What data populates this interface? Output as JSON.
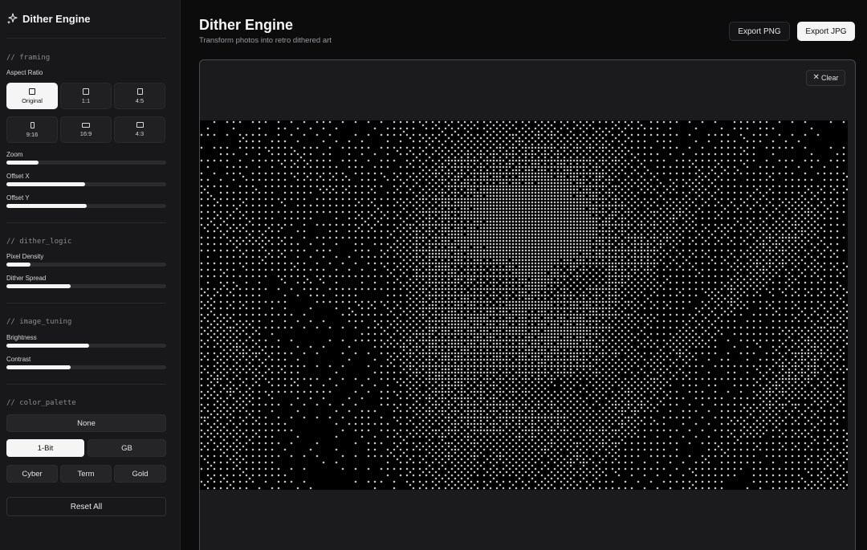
{
  "app": {
    "name": "Dither Engine"
  },
  "header": {
    "title": "Dither Engine",
    "subtitle": "Transform photos into retro dithered art",
    "export_png": "Export PNG",
    "export_jpg": "Export JPG"
  },
  "canvas": {
    "clear_label": "Clear",
    "clear_icon": "x-icon"
  },
  "framing": {
    "title": "// framing",
    "aspect_label": "Aspect Ratio",
    "ratios": [
      "Original",
      "1:1",
      "4:5",
      "9:16",
      "16:9",
      "4:3"
    ],
    "selected_ratio": "Original",
    "zoom": {
      "label": "Zoom",
      "value": 0.2
    },
    "offset_x": {
      "label": "Offset X",
      "value": 0.49
    },
    "offset_y": {
      "label": "Offset Y",
      "value": 0.5
    }
  },
  "dither_logic": {
    "title": "// dither_logic",
    "pixel_density": {
      "label": "Pixel Density",
      "value": 0.15
    },
    "dither_spread": {
      "label": "Dither Spread",
      "value": 0.4
    }
  },
  "image_tuning": {
    "title": "// image_tuning",
    "brightness": {
      "label": "Brightness",
      "value": 0.52
    },
    "contrast": {
      "label": "Contrast",
      "value": 0.4
    }
  },
  "color_palette": {
    "title": "// color_palette",
    "options": [
      "None",
      "1-Bit",
      "GB",
      "Cyber",
      "Term",
      "Gold"
    ],
    "selected": "1-Bit"
  },
  "reset_label": "Reset All",
  "colors": {
    "accent": "#f5f5f5",
    "sidebar_bg": "#18181a",
    "page_bg": "#0c0c0d"
  }
}
